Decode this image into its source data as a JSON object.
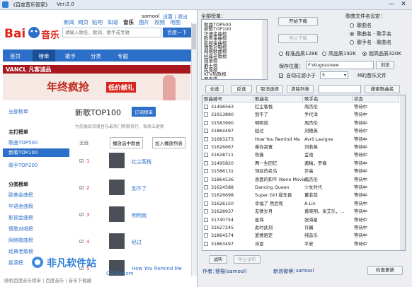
{
  "window": {
    "title": "《百度音乐管家》",
    "version": "Ver:2.0",
    "controls": [
      "—",
      "✕"
    ]
  },
  "browser": {
    "user": "samool",
    "user_links": "设置 | 退出",
    "logo_text": "音乐",
    "topnav": [
      "新闻",
      "网页",
      "贴吧",
      "知道",
      "音乐",
      "图片",
      "视频",
      "地图"
    ],
    "search_placeholder": "请输入歌名、歌词、歌手或专辑",
    "search_button": "百度一下",
    "nav": [
      "首页",
      "榜单",
      "歌手",
      "分类",
      "专题"
    ],
    "banner": {
      "brand": "VANCL 凡客诚品",
      "slogan": "年终疯抢",
      "badge": "低价献礼"
    },
    "sidebar": {
      "all": "全部榜单",
      "main_head": "主打榜单",
      "main": [
        "歌曲TOP500",
        "新歌TOP100",
        "歌手TOP200"
      ],
      "cat_head": "分类榜单",
      "cats": [
        "欧美金曲榜",
        "华语金曲榜",
        "影视金曲榜",
        "情歌对唱榜",
        "网络歌曲榜",
        "经典老歌榜",
        "摇滚榜"
      ]
    },
    "list": {
      "title": "新歌TOP100",
      "subscribe": "订阅榜单",
      "desc": "为您展现百度音乐最热门新歌排行，每周五更新",
      "select_all": "全选",
      "play_all": "播放选中歌曲",
      "add_list": "加入播放列表",
      "songs": [
        {
          "rank": "1",
          "title": "红尘客栈"
        },
        {
          "rank": "2",
          "title": "到不了"
        },
        {
          "rank": "3",
          "title": "明明就"
        },
        {
          "rank": "4",
          "title": "经过"
        },
        {
          "rank": "5",
          "title": "How You Remind Me"
        }
      ]
    }
  },
  "panel": {
    "catalog_label": "全部榜单：",
    "catalog": [
      "歌曲TOP500",
      "新歌TOP100",
      "华语金曲榜",
      "欧美金曲榜",
      "影视金曲榜",
      "情歌对唱榜",
      "网络歌曲榜",
      "经典老歌榜",
      "摇滚榜",
      "爵士榜",
      "民谣榜",
      "KTV热歌榜",
      "原声带"
    ],
    "start_download": "开始下载",
    "stop_download": "停止下载",
    "filename_label": "歌曲文件名设定：",
    "filename_opts": [
      "歌曲名",
      "歌曲名 - 歌手名",
      "歌手名 - 歌曲名"
    ],
    "quality": [
      "标准品质128K",
      "高品质192K",
      "超高品质320K"
    ],
    "save_label": "保存位置：",
    "save_path": "F:\\Kugou\\new",
    "browse": "浏览",
    "auto_filter": "自动过滤小于",
    "filter_size": "5",
    "filter_unit": "M的音乐文件",
    "toolbar": [
      "全选",
      "反选",
      "取消选择",
      "清除列表"
    ],
    "search_song": "搜索歌曲名",
    "columns": [
      "歌曲编号",
      "歌曲名",
      "歌手名",
      "状态"
    ],
    "songs": [
      {
        "id": "31496563",
        "name": "红尘客栈",
        "singer": "周杰伦",
        "status": "等待中"
      },
      {
        "id": "31913890",
        "name": "到不了",
        "singer": "手代洋",
        "status": "等待中"
      },
      {
        "id": "31583990",
        "name": "明明就",
        "singer": "周杰伦",
        "status": "等待中"
      },
      {
        "id": "31864497",
        "name": "经过",
        "singer": "刘德英",
        "status": "等待中"
      },
      {
        "id": "31683273",
        "name": "How You Remind Me",
        "singer": "Avril Lavigne",
        "status": "等待中"
      },
      {
        "id": "31626667",
        "name": "乘你寂寞",
        "singer": "刘若英",
        "status": "等待中"
      },
      {
        "id": "31628711",
        "name": "伤痛",
        "singer": "金池",
        "status": "等待中"
      },
      {
        "id": "31495820",
        "name": "两一生回忆",
        "singer": "邀稿，罗春",
        "status": "等待中"
      },
      {
        "id": "31586131",
        "name": "领别的名鸟",
        "singer": "步高",
        "status": "等待中"
      },
      {
        "id": "31864536",
        "name": "表面的和平 (Kene Movie...",
        "singer": "周杰伦",
        "status": "等待中"
      },
      {
        "id": "31624588",
        "name": "Dancing Queen",
        "singer": "少女时代",
        "status": "等待中"
      },
      {
        "id": "31626698",
        "name": "Super Girl 我无畏",
        "singer": "董菲菲",
        "status": "等待中"
      },
      {
        "id": "31626150",
        "name": "幸福了 然后呢",
        "singer": "A-Lin",
        "status": "等待中"
      },
      {
        "id": "31628937",
        "name": "友情岁月",
        "singer": "黄晓明，米艾乐，...",
        "status": "等待中"
      },
      {
        "id": "31740754",
        "name": "星海",
        "singer": "张海星",
        "status": "等待中"
      },
      {
        "id": "31627245",
        "name": "此时此刻",
        "singer": "许巍",
        "status": "等待中"
      },
      {
        "id": "31864574",
        "name": "爱情限定",
        "singer": "纯音乐",
        "status": "等待中"
      },
      {
        "id": "31863497",
        "name": "泽恩",
        "singer": "平安",
        "status": "等待中"
      }
    ],
    "test_btn": "试听",
    "stop_test": "停止试听",
    "author_label": "作者：",
    "author": "瘦猫(samool)",
    "blog_label": "新浪微博：",
    "blog": "samool",
    "update": "检查更新"
  },
  "watermark": {
    "site": "非凡软件站",
    "domain": "CRSKY.com"
  },
  "statusbar": "随机百度音乐榜单 | 百度音乐 | 音乐下载器"
}
